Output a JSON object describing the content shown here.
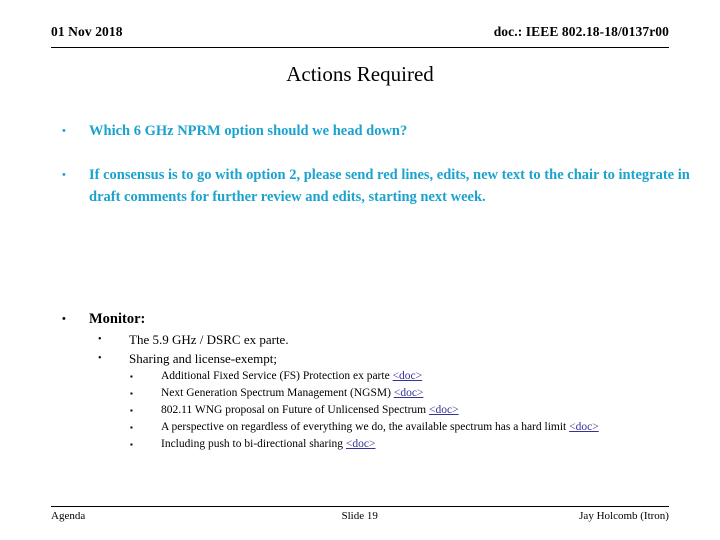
{
  "header": {
    "date": "01 Nov 2018",
    "doc": "doc.: IEEE 802.18-18/0137r00"
  },
  "title": "Actions Required",
  "colors": {
    "accent_cyan": "#1BA3CE",
    "link_blue": "#333399",
    "text_black": "#000000"
  },
  "bullets": {
    "b1": "Which 6 GHz NPRM option should we head down?",
    "b2": "If consensus is to go with option 2, please send red lines, edits, new text to the chair to integrate in draft comments for further review and edits, starting next week.",
    "b3": "Monitor:",
    "sub": [
      "The 5.9 GHz / DSRC ex parte.",
      "Sharing and license-exempt;"
    ],
    "sub_sub": [
      {
        "text": "Additional Fixed Service (FS) Protection ex parte",
        "link": "<doc>"
      },
      {
        "text": "Next Generation Spectrum Management (NGSM)",
        "link": "<doc>"
      },
      {
        "text": "802.11 WNG proposal on Future of Unlicensed Spectrum",
        "link": "<doc>"
      },
      {
        "text": "A perspective on regardless of everything we do, the available spectrum has a hard limit",
        "link": "<doc>"
      },
      {
        "text": "Including push to bi-directional sharing",
        "link": "<doc>"
      }
    ]
  },
  "markers": {
    "round": "•",
    "square": "▪"
  },
  "footer": {
    "left": "Agenda",
    "center": "Slide 19",
    "right": "Jay Holcomb (Itron)"
  }
}
